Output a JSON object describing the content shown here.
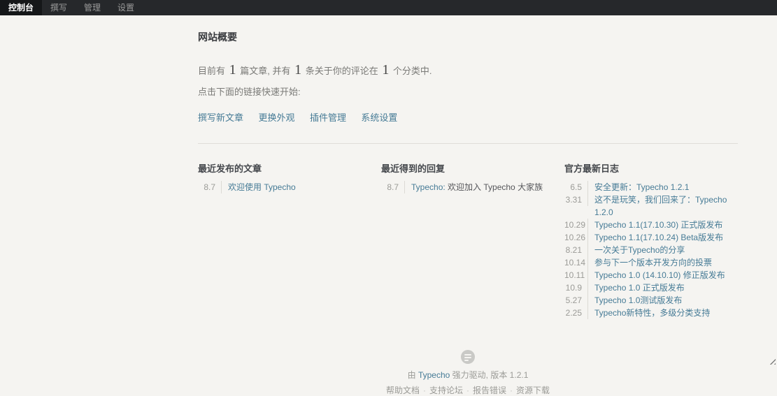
{
  "nav": {
    "items": [
      {
        "label": "控制台",
        "active": true
      },
      {
        "label": "撰写",
        "active": false
      },
      {
        "label": "管理",
        "active": false
      },
      {
        "label": "设置",
        "active": false
      }
    ]
  },
  "overview": {
    "title": "网站概要",
    "stats": {
      "prefix": "目前有 ",
      "posts": "1",
      "mid1": " 篇文章, 并有 ",
      "comments": "1",
      "mid2": " 条关于你的评论在 ",
      "categories": "1",
      "suffix": " 个分类中."
    },
    "quickstart_hint": "点击下面的链接快速开始:",
    "quick_links": [
      "撰写新文章",
      "更换外观",
      "插件管理",
      "系统设置"
    ]
  },
  "columns": [
    {
      "title": "最近发布的文章",
      "items": [
        {
          "date": "8.7",
          "title": "欢迎使用 Typecho"
        }
      ]
    },
    {
      "title": "最近得到的回复",
      "items": [
        {
          "date": "8.7",
          "author": "Typecho:",
          "text": " 欢迎加入 Typecho 大家族"
        }
      ]
    },
    {
      "title": "官方最新日志",
      "items": [
        {
          "date": "6.5",
          "title": "安全更新：Typecho 1.2.1"
        },
        {
          "date": "3.31",
          "title": "这不是玩笑，我们回来了：Typecho 1.2.0"
        },
        {
          "date": "10.29",
          "title": "Typecho 1.1(17.10.30) 正式版发布"
        },
        {
          "date": "10.26",
          "title": "Typecho 1.1(17.10.24) Beta版发布"
        },
        {
          "date": "8.21",
          "title": "一次关于Typecho的分享"
        },
        {
          "date": "10.14",
          "title": "参与下一个版本开发方向的投票"
        },
        {
          "date": "10.11",
          "title": "Typecho 1.0 (14.10.10) 修正版发布"
        },
        {
          "date": "10.9",
          "title": "Typecho 1.0 正式版发布"
        },
        {
          "date": "5.27",
          "title": "Typecho 1.0测试版发布"
        },
        {
          "date": "2.25",
          "title": "Typecho新特性，多级分类支持"
        }
      ]
    }
  ],
  "footer": {
    "logo_icon": "typecho-logo",
    "powered_prefix": "由 ",
    "powered_link": "Typecho",
    "powered_suffix": " 强力驱动, 版本 1.2.1",
    "links": [
      "帮助文档",
      "支持论坛",
      "报告错误",
      "资源下载"
    ],
    "separator": "·"
  },
  "colors": {
    "accent_link": "#467B96",
    "nav_bg": "#26282B",
    "nav_active_bg": "#151719",
    "page_bg": "#F5F4F1",
    "muted_text": "#9B9B97"
  }
}
